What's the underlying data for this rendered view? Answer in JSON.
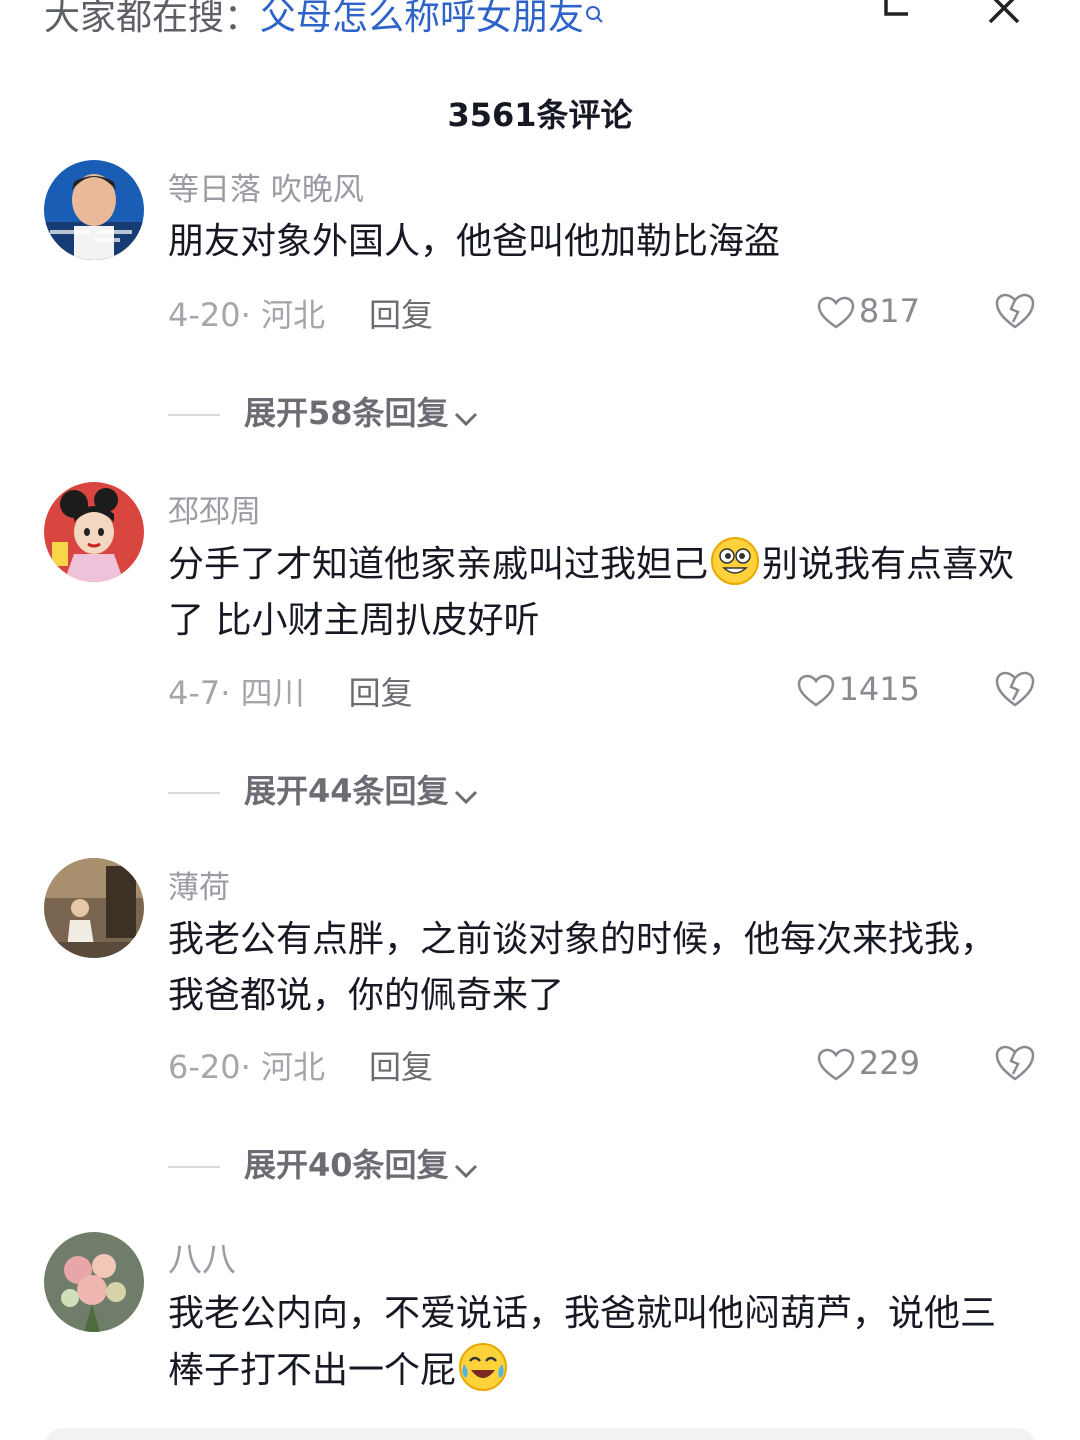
{
  "header": {
    "search_prefix": "大家都在搜：",
    "search_query": "父母怎么称呼女朋友",
    "comment_count": "3561条评论"
  },
  "comments": [
    {
      "username": "等日落 吹晚风",
      "text": "朋友对象外国人，他爸叫他加勒比海盗",
      "date_location": "4-20· 河北",
      "reply_label": "回复",
      "likes": "817",
      "expand_label": "展开58条回复"
    },
    {
      "username": "邳邳周",
      "text_part1": "分手了才知道他家亲戚叫过我妲己",
      "emoji1": "silly-face-emoji",
      "text_part2": "别说我有点喜欢了 比小财主周扒皮好听",
      "date_location": "4-7· 四川",
      "reply_label": "回复",
      "likes": "1415",
      "expand_label": "展开44条回复"
    },
    {
      "username": "薄荷",
      "text": "我老公有点胖，之前谈对象的时候，他每次来找我，我爸都说，你的佩奇来了",
      "date_location": "6-20· 河北",
      "reply_label": "回复",
      "likes": "229",
      "expand_label": "展开40条回复"
    },
    {
      "username": "八八",
      "text": "我老公内向，不爱说话，我爸就叫他闷葫芦，说他三棒子打不出一个屁",
      "emoji": "laugh-cry-emoji"
    }
  ]
}
